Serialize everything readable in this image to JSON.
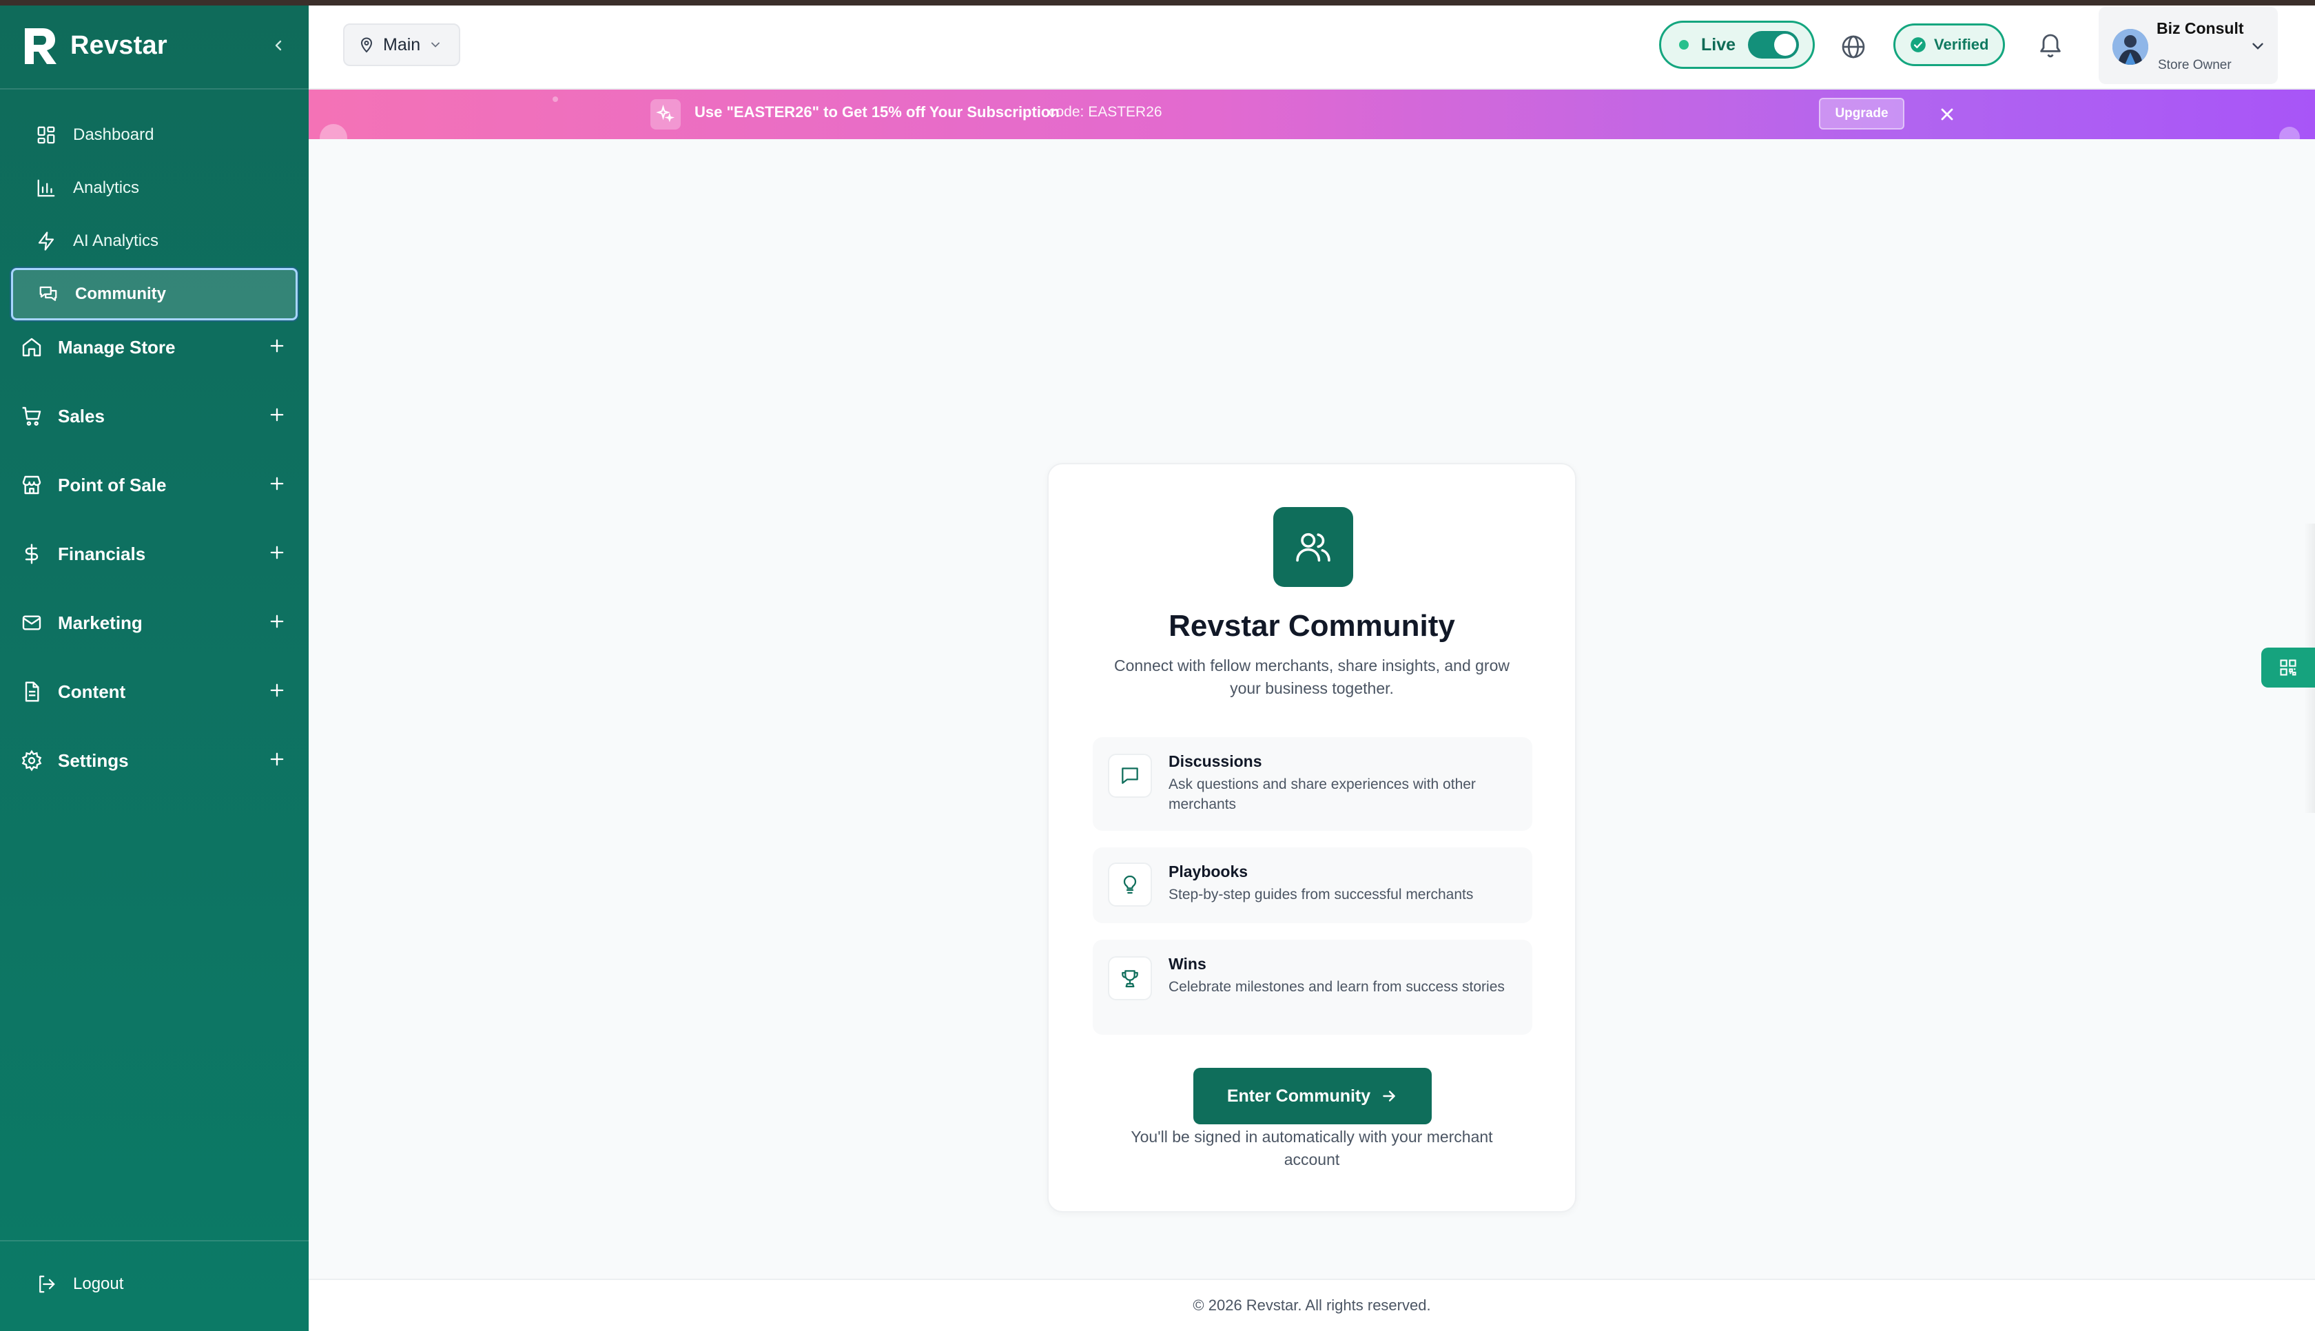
{
  "sidebar": {
    "brand": "Revstar",
    "sub_items": [
      {
        "label": "Dashboard",
        "icon": "dashboard-icon"
      },
      {
        "label": "Analytics",
        "icon": "bar-chart-icon"
      },
      {
        "label": "AI Analytics",
        "icon": "lightning-icon"
      },
      {
        "label": "Community",
        "icon": "chat-bubbles-icon",
        "active": true
      }
    ],
    "groups": [
      {
        "label": "Manage Store",
        "icon": "home-icon"
      },
      {
        "label": "Sales",
        "icon": "cart-icon"
      },
      {
        "label": "Point of Sale",
        "icon": "store-icon"
      },
      {
        "label": "Financials",
        "icon": "dollar-icon"
      },
      {
        "label": "Marketing",
        "icon": "mail-icon"
      },
      {
        "label": "Content",
        "icon": "document-icon"
      },
      {
        "label": "Settings",
        "icon": "gear-icon"
      }
    ],
    "logout": "Logout"
  },
  "header": {
    "location": "Main",
    "live_label": "Live",
    "live_on": true,
    "verified_label": "Verified",
    "user": {
      "name": "Biz Consult",
      "role": "Store Owner"
    }
  },
  "promo": {
    "text": "Use \"EASTER26\" to Get 15% off Your Subscription",
    "code": "code: EASTER26",
    "upgrade": "Upgrade"
  },
  "community": {
    "title": "Revstar Community",
    "subtitle": "Connect with fellow merchants, share insights, and grow your business together.",
    "features": [
      {
        "title": "Discussions",
        "desc": "Ask questions and share experiences with other merchants",
        "icon": "message-icon"
      },
      {
        "title": "Playbooks",
        "desc": "Step-by-step guides from successful merchants",
        "icon": "lightbulb-icon"
      },
      {
        "title": "Wins",
        "desc": "Celebrate milestones and learn from success stories",
        "icon": "trophy-icon"
      }
    ],
    "cta": "Enter Community",
    "note": "You'll be signed in automatically with your merchant account"
  },
  "footer": {
    "text": "© 2026 Revstar. All rights reserved."
  },
  "colors": {
    "brand": "#0f6e5b",
    "accent": "#14a67f",
    "promo_start": "#f472b6",
    "promo_end": "#a855f7"
  }
}
